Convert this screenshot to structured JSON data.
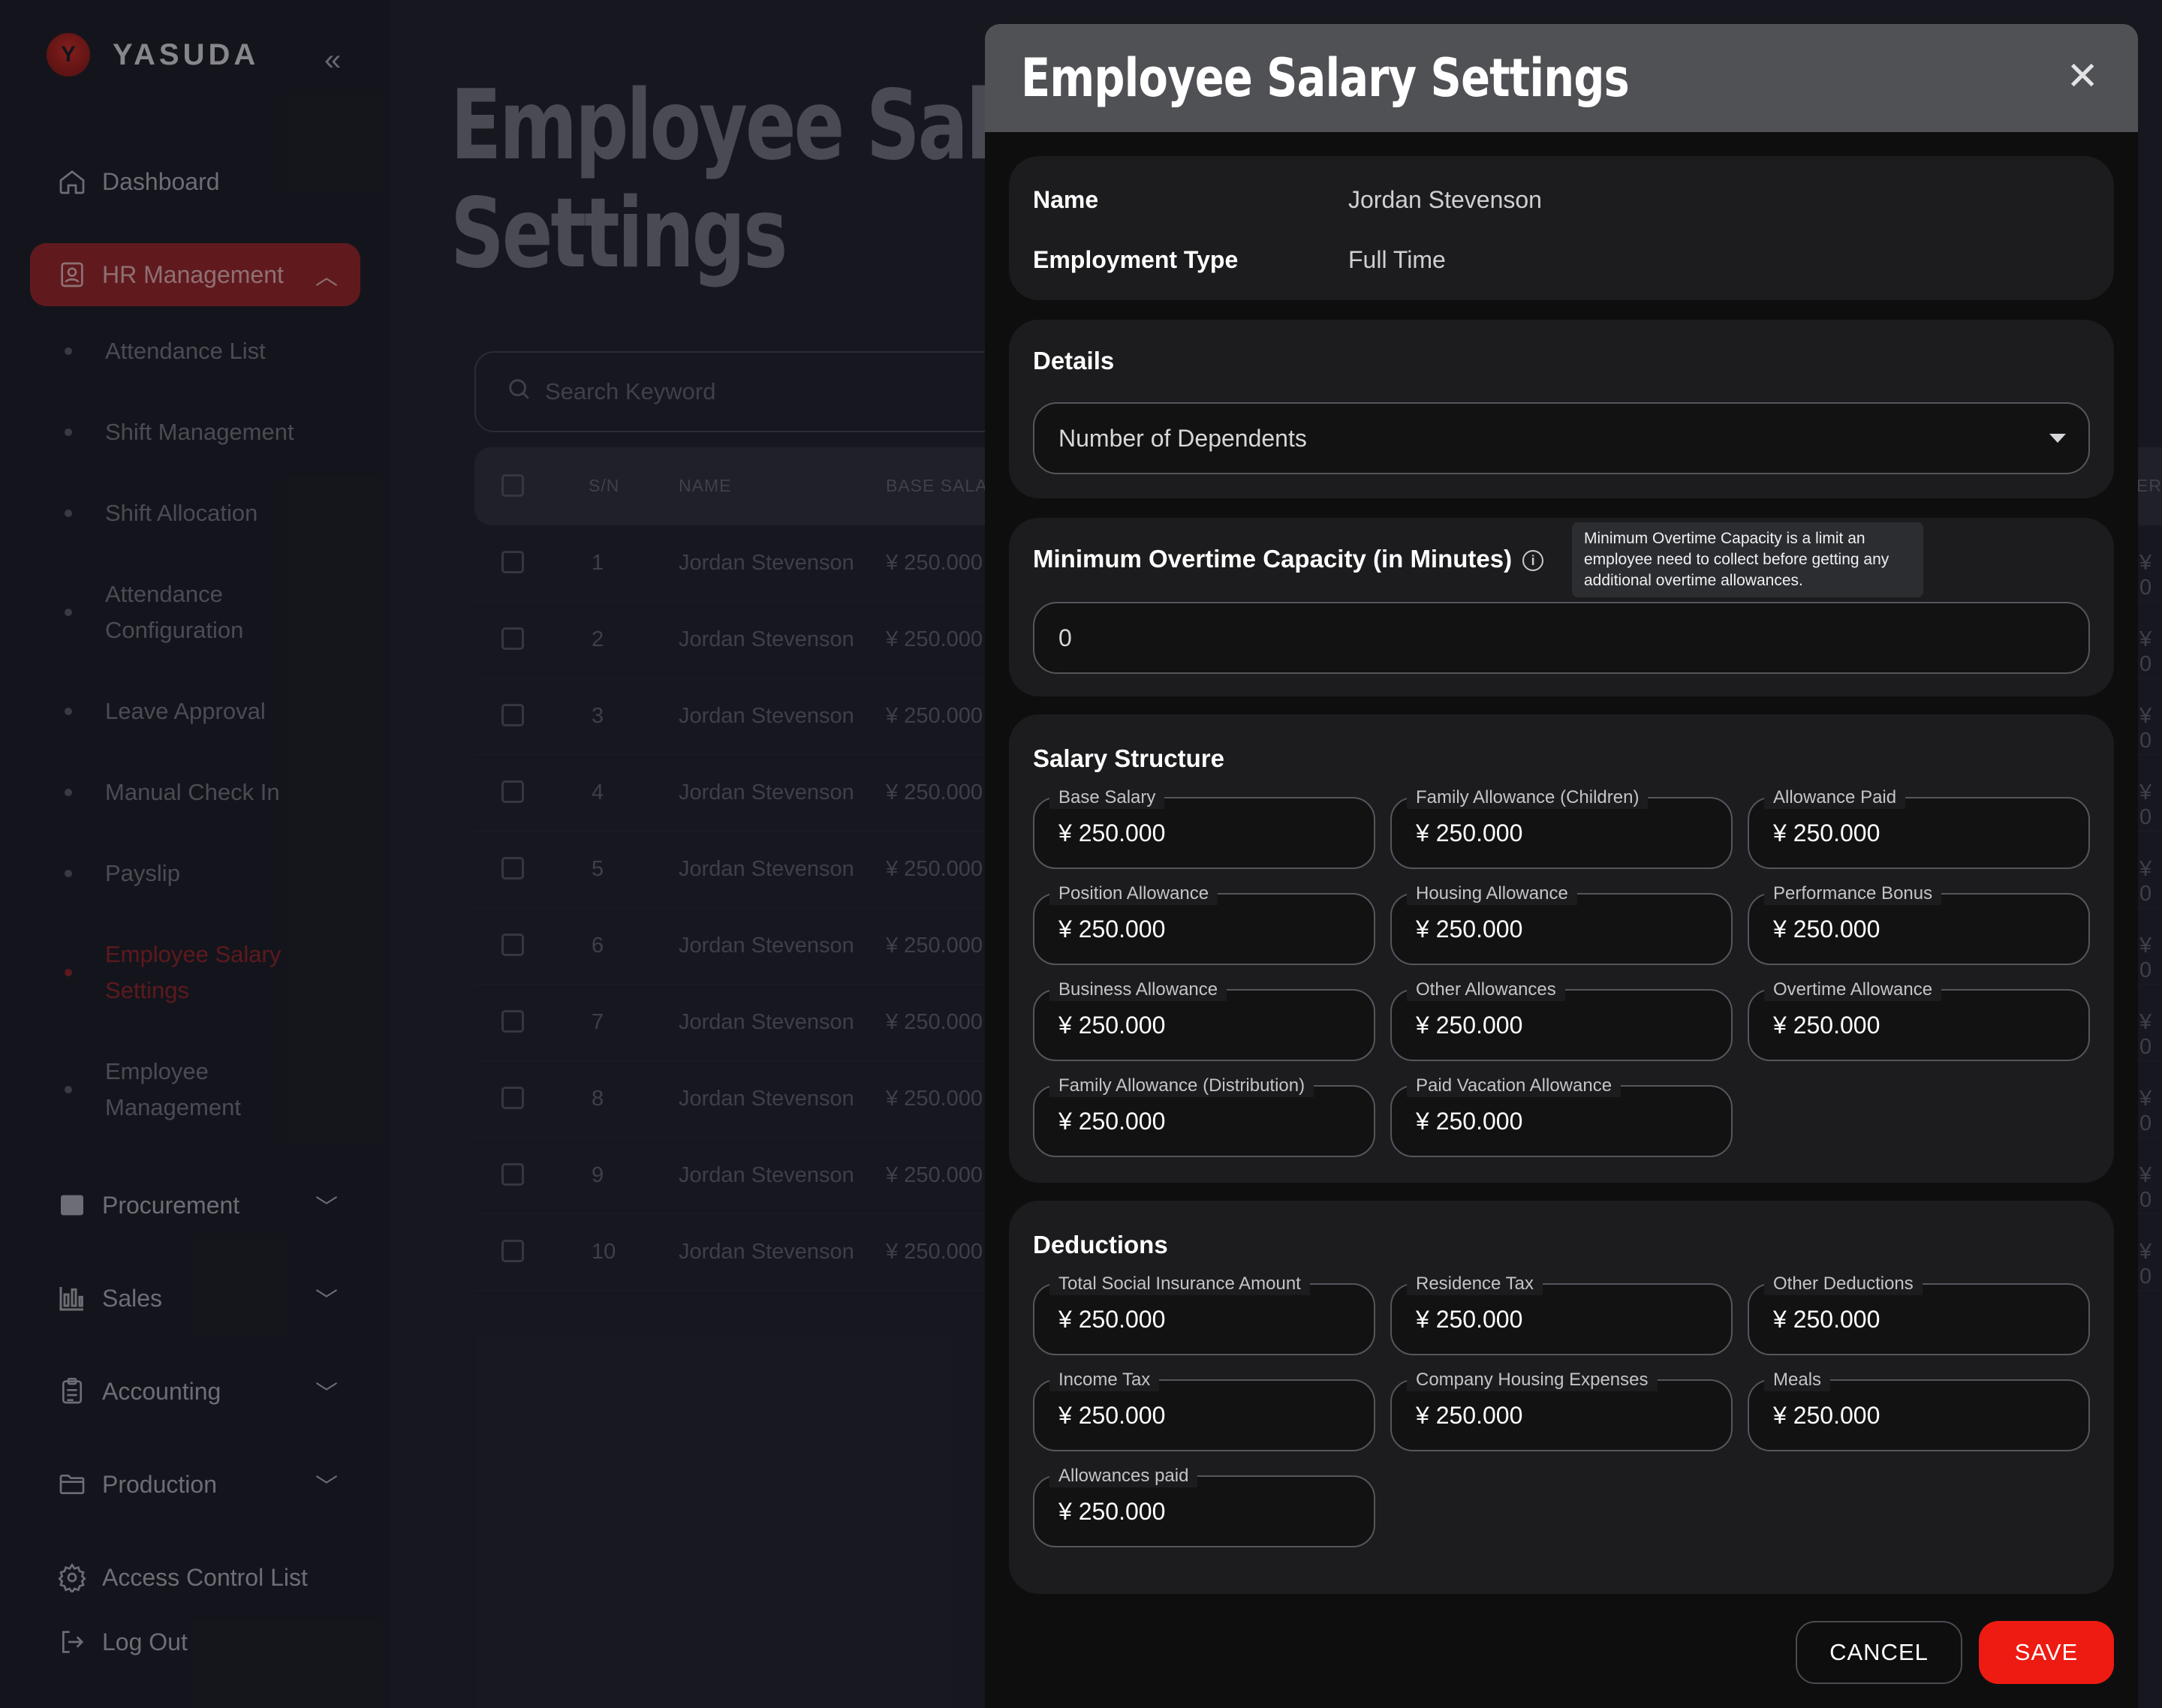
{
  "brand": {
    "name": "YASUDA",
    "logo": "Y"
  },
  "sidebar": {
    "dashboard": "Dashboard",
    "hr": "HR Management",
    "sub": [
      "Attendance List",
      "Shift Management",
      "Shift Allocation",
      "Attendance Configuration",
      "Leave Approval",
      "Manual Check In",
      "Payslip",
      "Employee Salary Settings",
      "Employee Management"
    ],
    "procurement": "Procurement",
    "sales": "Sales",
    "accounting": "Accounting",
    "production": "Production",
    "acl": "Access Control List",
    "logout": "Log Out"
  },
  "page": {
    "title_line1": "Employee Sala",
    "title_line2": "Settings",
    "search_placeholder": "Search Keyword"
  },
  "table": {
    "headers": {
      "sn": "S/N",
      "name": "NAME",
      "base": "BASE SALAR",
      "edge": "ERI"
    },
    "rows": [
      {
        "sn": "1",
        "name": "Jordan Stevenson",
        "base": "¥ 250.000",
        "edge": "¥ 0"
      },
      {
        "sn": "2",
        "name": "Jordan Stevenson",
        "base": "¥ 250.000",
        "edge": "¥ 0"
      },
      {
        "sn": "3",
        "name": "Jordan Stevenson",
        "base": "¥ 250.000",
        "edge": "¥ 0"
      },
      {
        "sn": "4",
        "name": "Jordan Stevenson",
        "base": "¥ 250.000",
        "edge": "¥ 0"
      },
      {
        "sn": "5",
        "name": "Jordan Stevenson",
        "base": "¥ 250.000",
        "edge": "¥ 0"
      },
      {
        "sn": "6",
        "name": "Jordan Stevenson",
        "base": "¥ 250.000",
        "edge": "¥ 0"
      },
      {
        "sn": "7",
        "name": "Jordan Stevenson",
        "base": "¥ 250.000",
        "edge": "¥ 0"
      },
      {
        "sn": "8",
        "name": "Jordan Stevenson",
        "base": "¥ 250.000",
        "edge": "¥ 0"
      },
      {
        "sn": "9",
        "name": "Jordan Stevenson",
        "base": "¥ 250.000",
        "edge": "¥ 0"
      },
      {
        "sn": "10",
        "name": "Jordan Stevenson",
        "base": "¥ 250.000",
        "edge": "¥ 0"
      }
    ]
  },
  "modal": {
    "title": "Employee Salary Settings",
    "close": "✕",
    "name_label": "Name",
    "name_value": "Jordan Stevenson",
    "employment_label": "Employment Type",
    "employment_value": "Full Time",
    "details_title": "Details",
    "dependents_select": "Number of Dependents",
    "overtime_label": "Minimum Overtime Capacity  (in Minutes)",
    "overtime_tooltip": "Minimum Overtime Capacity is a limit an employee need to collect before getting any additional overtime allowances.",
    "overtime_value": "0",
    "salary_title": "Salary Structure",
    "salary_fields": [
      {
        "label": "Base Salary",
        "value": "¥ 250.000"
      },
      {
        "label": "Family Allowance (Children)",
        "value": "¥ 250.000"
      },
      {
        "label": "Allowance Paid",
        "value": "¥ 250.000"
      },
      {
        "label": "Position Allowance",
        "value": "¥ 250.000"
      },
      {
        "label": "Housing Allowance",
        "value": "¥ 250.000"
      },
      {
        "label": "Performance Bonus",
        "value": "¥ 250.000"
      },
      {
        "label": "Business Allowance",
        "value": "¥ 250.000"
      },
      {
        "label": "Other Allowances",
        "value": "¥ 250.000"
      },
      {
        "label": "Overtime Allowance",
        "value": "¥ 250.000"
      },
      {
        "label": "Family Allowance (Distribution)",
        "value": "¥ 250.000"
      },
      {
        "label": "Paid Vacation Allowance",
        "value": "¥ 250.000"
      }
    ],
    "deductions_title": "Deductions",
    "deduction_fields": [
      {
        "label": "Total Social Insurance Amount",
        "value": "¥ 250.000"
      },
      {
        "label": "Residence Tax",
        "value": "¥ 250.000"
      },
      {
        "label": "Other Deductions",
        "value": "¥ 250.000"
      },
      {
        "label": "Income Tax",
        "value": "¥ 250.000"
      },
      {
        "label": "Company Housing Expenses",
        "value": "¥ 250.000"
      },
      {
        "label": "Meals",
        "value": "¥ 250.000"
      },
      {
        "label": "Allowances paid",
        "value": "¥ 250.000"
      }
    ],
    "cancel": "CANCEL",
    "save": "SAVE"
  }
}
